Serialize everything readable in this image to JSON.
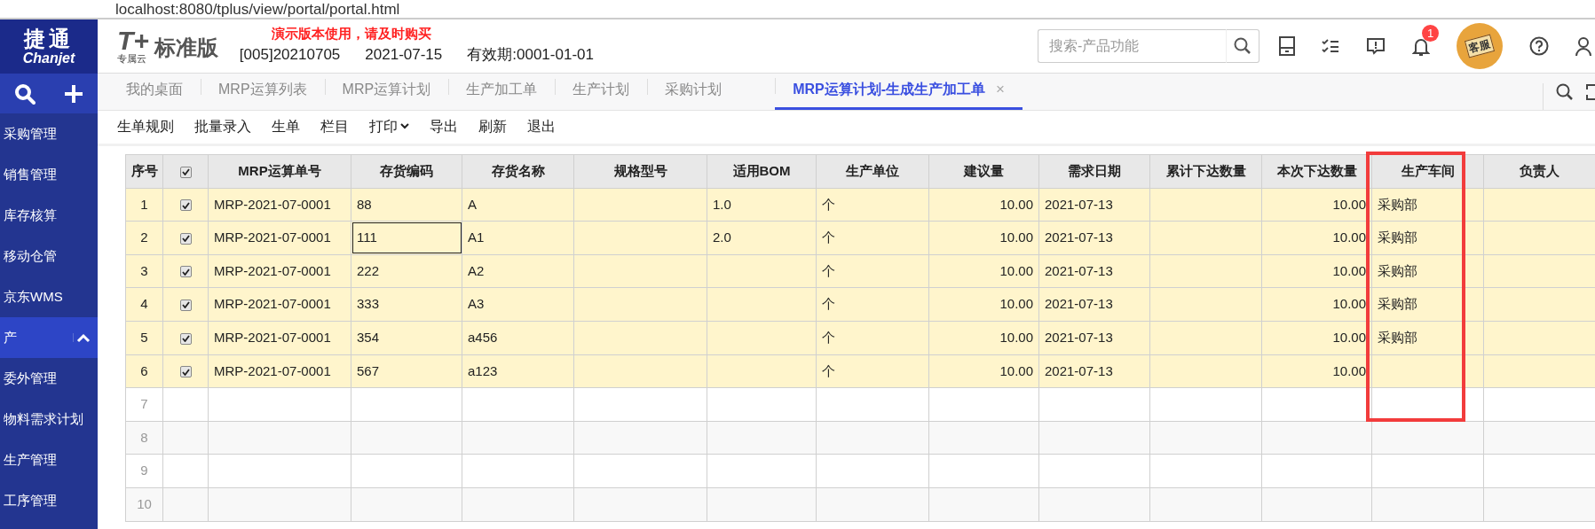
{
  "browser": {
    "url": "localhost:8080/tplus/view/portal/portal.html"
  },
  "brand": {
    "logo_cn": "捷通",
    "logo_en": "Chanjet"
  },
  "sidebar": {
    "items": [
      {
        "label": "采购管理",
        "expanded": false,
        "selected": false
      },
      {
        "label": "销售管理",
        "expanded": false,
        "selected": false
      },
      {
        "label": "库存核算",
        "expanded": false,
        "selected": false
      },
      {
        "label": "移动仓管",
        "expanded": false,
        "selected": false
      },
      {
        "label": "京东WMS",
        "expanded": false,
        "selected": false
      },
      {
        "label": "产",
        "expanded": true,
        "selected": true
      },
      {
        "label": "委外管理",
        "expanded": false,
        "selected": false
      },
      {
        "label": "物料需求计划",
        "expanded": false,
        "selected": false
      },
      {
        "label": "生产管理",
        "expanded": false,
        "selected": false
      },
      {
        "label": "工序管理",
        "expanded": false,
        "selected": false
      }
    ]
  },
  "header": {
    "product_mark": "T+",
    "product_sub": "专属云",
    "edition": "标准版",
    "notice": "演示版本使用，请及时购买",
    "account": "[005]20210705",
    "date": "2021-07-15",
    "validity": "有效期:0001-01-01",
    "search": {
      "placeholder": "搜索-产品功能"
    },
    "notification_count": "1",
    "service_label": "客服"
  },
  "tabs": [
    {
      "label": "我的桌面",
      "selected": false
    },
    {
      "label": "MRP运算列表",
      "selected": false
    },
    {
      "label": "MRP运算计划",
      "selected": false
    },
    {
      "label": "生产加工单",
      "selected": false
    },
    {
      "label": "生产计划",
      "selected": false
    },
    {
      "label": "采购计划",
      "selected": false
    },
    {
      "label": "MRP运算计划-生成生产加工单",
      "selected": true,
      "close": "×"
    }
  ],
  "toolbar": [
    {
      "label": "生单规则",
      "dropdown": false
    },
    {
      "label": "批量录入",
      "dropdown": false
    },
    {
      "label": "生单",
      "dropdown": false
    },
    {
      "label": "栏目",
      "dropdown": false
    },
    {
      "label": "打印",
      "dropdown": true
    },
    {
      "label": "导出",
      "dropdown": false
    },
    {
      "label": "刷新",
      "dropdown": false
    },
    {
      "label": "退出",
      "dropdown": false
    }
  ],
  "table": {
    "header_checked": true,
    "columns": [
      "序号",
      "MRP运算单号",
      "存货编码",
      "存货名称",
      "规格型号",
      "适用BOM",
      "生产单位",
      "建议量",
      "需求日期",
      "累计下达数量",
      "本次下达数量",
      "生产车间",
      "负责人"
    ],
    "rows": [
      {
        "no": "1",
        "checked": true,
        "code_focused": false,
        "cells": [
          "MRP-2021-07-0001",
          "88",
          "A",
          "",
          "1.0",
          "个",
          "10.00",
          "2021-07-13",
          "",
          "10.00",
          "采购部",
          ""
        ]
      },
      {
        "no": "2",
        "checked": true,
        "code_focused": true,
        "cells": [
          "MRP-2021-07-0001",
          "111",
          "A1",
          "",
          "2.0",
          "个",
          "10.00",
          "2021-07-13",
          "",
          "10.00",
          "采购部",
          ""
        ]
      },
      {
        "no": "3",
        "checked": true,
        "code_focused": false,
        "cells": [
          "MRP-2021-07-0001",
          "222",
          "A2",
          "",
          "",
          "个",
          "10.00",
          "2021-07-13",
          "",
          "10.00",
          "采购部",
          ""
        ]
      },
      {
        "no": "4",
        "checked": true,
        "code_focused": false,
        "cells": [
          "MRP-2021-07-0001",
          "333",
          "A3",
          "",
          "",
          "个",
          "10.00",
          "2021-07-13",
          "",
          "10.00",
          "采购部",
          ""
        ]
      },
      {
        "no": "5",
        "checked": true,
        "code_focused": false,
        "cells": [
          "MRP-2021-07-0001",
          "354",
          "a456",
          "",
          "",
          "个",
          "10.00",
          "2021-07-13",
          "",
          "10.00",
          "采购部",
          ""
        ]
      },
      {
        "no": "6",
        "checked": true,
        "code_focused": false,
        "cells": [
          "MRP-2021-07-0001",
          "567",
          "a123",
          "",
          "",
          "个",
          "10.00",
          "2021-07-13",
          "",
          "10.00",
          "",
          ""
        ]
      },
      {
        "no": "7"
      },
      {
        "no": "8"
      },
      {
        "no": "9"
      },
      {
        "no": "10"
      }
    ]
  }
}
